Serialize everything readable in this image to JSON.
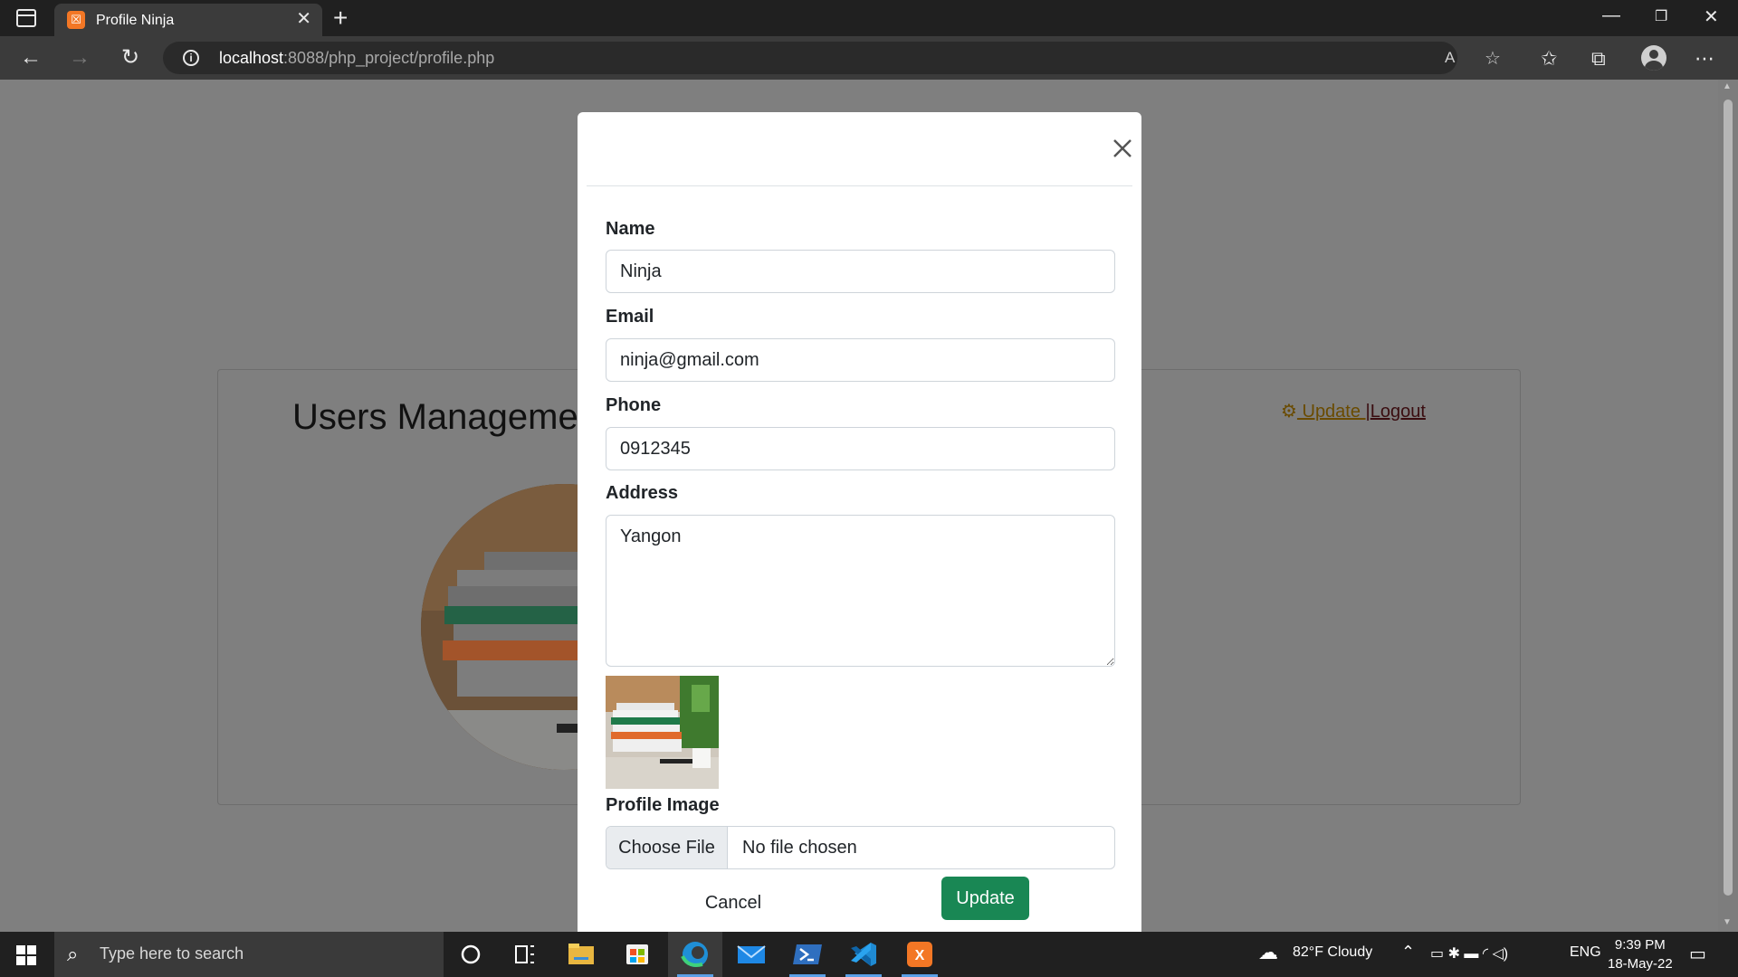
{
  "browser": {
    "tab_title": "Profile Ninja",
    "url_host": "localhost",
    "url_rest": ":8088/php_project/profile.php"
  },
  "page": {
    "title": "Users Manageme",
    "update_link": " Update ",
    "separator": "|",
    "logout_link": "Logout"
  },
  "modal": {
    "name_label": "Name",
    "name_value": "Ninja",
    "email_label": "Email",
    "email_value": "ninja@gmail.com",
    "phone_label": "Phone",
    "phone_value": "0912345",
    "address_label": "Address",
    "address_value": "Yangon",
    "profile_image_label": "Profile Image",
    "choose_file_label": "Choose File",
    "no_file_text": "No file chosen",
    "cancel_label": "Cancel",
    "update_label": "Update"
  },
  "taskbar": {
    "search_placeholder": "Type here to search",
    "weather": "82°F  Cloudy",
    "language": "ENG",
    "time": "9:39 PM",
    "date": "18-May-22"
  },
  "colors": {
    "primary_button": "#198754",
    "backdrop": "#7f7f7f",
    "browser_chrome": "#3b3b3b",
    "taskbar": "#202020"
  },
  "icons": [
    "tab-actions-icon",
    "xampp-favicon-icon",
    "close-icon",
    "plus-icon",
    "back-icon",
    "forward-icon",
    "refresh-icon",
    "info-icon",
    "read-aloud-icon",
    "favorite-add-icon",
    "favorites-icon",
    "collections-icon",
    "profile-icon",
    "more-icon",
    "gear-icon",
    "windows-start-icon",
    "search-icon",
    "cortana-icon",
    "task-view-icon",
    "file-explorer-icon",
    "store-icon",
    "edge-icon",
    "mail-icon",
    "powershell-icon",
    "vscode-icon",
    "xampp-icon",
    "cloud-icon",
    "chevron-up-icon",
    "notification-icon"
  ]
}
